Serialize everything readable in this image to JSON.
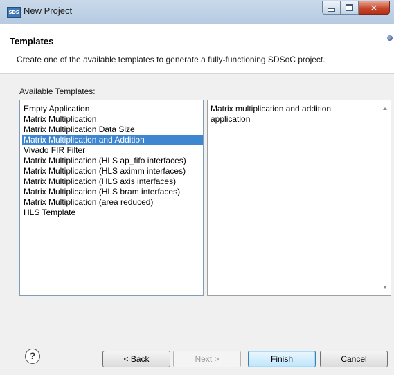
{
  "window": {
    "app_icon_text": "SDS",
    "title": "New Project"
  },
  "header": {
    "title": "Templates",
    "description": "Create one of the available templates to generate a fully-functioning SDSoC project."
  },
  "templates": {
    "label": "Available Templates:",
    "selected_index": 3,
    "items": [
      "Empty Application",
      "Matrix Multiplication",
      "Matrix Multiplication Data Size",
      "Matrix Multiplication and Addition",
      "Vivado FIR Filter",
      "Matrix Multiplication (HLS ap_fifo interfaces)",
      "Matrix Multiplication (HLS aximm interfaces)",
      "Matrix Multiplication (HLS axis interfaces)",
      "Matrix Multiplication (HLS bram interfaces)",
      "Matrix Multiplication (area reduced)",
      "HLS Template"
    ],
    "description": "Matrix multiplication and addition application"
  },
  "footer": {
    "help_glyph": "?",
    "back_label": "< Back",
    "next_label": "Next >",
    "finish_label": "Finish",
    "cancel_label": "Cancel"
  },
  "colors": {
    "selection": "#3f86d0",
    "titlebar": "#c9d9ea",
    "close_button": "#c7472b"
  }
}
